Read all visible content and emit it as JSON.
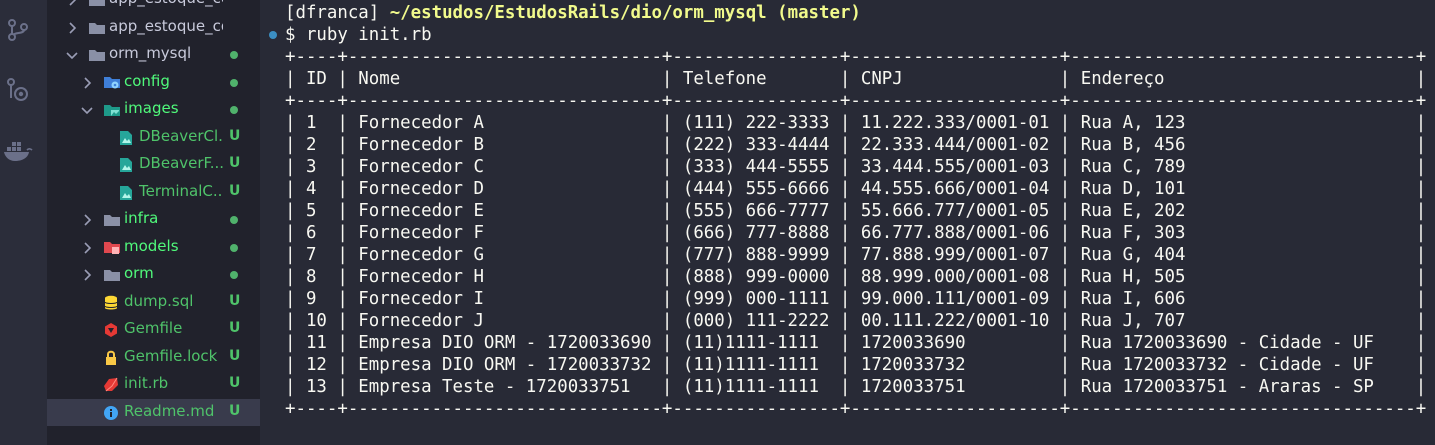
{
  "explorer": {
    "items": [
      {
        "label": "app_estoque_con...",
        "kind": "folder",
        "expanded": false,
        "indent": 0,
        "status": ""
      },
      {
        "label": "app_estoque_con...",
        "kind": "folder",
        "expanded": false,
        "indent": 0,
        "status": ""
      },
      {
        "label": "orm_mysql",
        "kind": "folder",
        "expanded": true,
        "indent": 0,
        "status": "dot"
      },
      {
        "label": "config",
        "kind": "folder-config",
        "expanded": false,
        "indent": 1,
        "status": "dot"
      },
      {
        "label": "images",
        "kind": "folder-images",
        "expanded": true,
        "indent": 1,
        "status": "dot"
      },
      {
        "label": "DBeaverCl...",
        "kind": "image",
        "expanded": null,
        "indent": 2,
        "status": "U"
      },
      {
        "label": "DBeaverF...",
        "kind": "image",
        "expanded": null,
        "indent": 2,
        "status": "U"
      },
      {
        "label": "TerminalC...",
        "kind": "image",
        "expanded": null,
        "indent": 2,
        "status": "U"
      },
      {
        "label": "infra",
        "kind": "folder",
        "expanded": false,
        "indent": 1,
        "status": "dot"
      },
      {
        "label": "models",
        "kind": "folder-models",
        "expanded": false,
        "indent": 1,
        "status": "dot"
      },
      {
        "label": "orm",
        "kind": "folder",
        "expanded": false,
        "indent": 1,
        "status": "dot"
      },
      {
        "label": "dump.sql",
        "kind": "sql",
        "expanded": null,
        "indent": 1,
        "status": "U"
      },
      {
        "label": "Gemfile",
        "kind": "gemfile",
        "expanded": null,
        "indent": 1,
        "status": "U"
      },
      {
        "label": "Gemfile.lock",
        "kind": "lock",
        "expanded": null,
        "indent": 1,
        "status": "U"
      },
      {
        "label": "init.rb",
        "kind": "ruby",
        "expanded": null,
        "indent": 1,
        "status": "U"
      },
      {
        "label": "Readme.md",
        "kind": "info",
        "expanded": null,
        "indent": 1,
        "status": "U",
        "selected": true
      }
    ]
  },
  "terminal": {
    "prompt": {
      "user": "[dfranca]",
      "path": "~/estudos/EstudosRails/dio/orm_mysql",
      "branch": "(master)"
    },
    "command": "$ ruby init.rb",
    "border": "+----+------------------------------+----------------+--------------------+---------------------------------+",
    "headers": [
      "ID",
      "Nome",
      "Telefone",
      "CNPJ",
      "Endereço"
    ],
    "rows": [
      [
        "1",
        "Fornecedor A",
        "(111) 222-3333",
        "11.222.333/0001-01",
        "Rua A, 123"
      ],
      [
        "2",
        "Fornecedor B",
        "(222) 333-4444",
        "22.333.444/0001-02",
        "Rua B, 456"
      ],
      [
        "3",
        "Fornecedor C",
        "(333) 444-5555",
        "33.444.555/0001-03",
        "Rua C, 789"
      ],
      [
        "4",
        "Fornecedor D",
        "(444) 555-6666",
        "44.555.666/0001-04",
        "Rua D, 101"
      ],
      [
        "5",
        "Fornecedor E",
        "(555) 666-7777",
        "55.666.777/0001-05",
        "Rua E, 202"
      ],
      [
        "6",
        "Fornecedor F",
        "(666) 777-8888",
        "66.777.888/0001-06",
        "Rua F, 303"
      ],
      [
        "7",
        "Fornecedor G",
        "(777) 888-9999",
        "77.888.999/0001-07",
        "Rua G, 404"
      ],
      [
        "8",
        "Fornecedor H",
        "(888) 999-0000",
        "88.999.000/0001-08",
        "Rua H, 505"
      ],
      [
        "9",
        "Fornecedor I",
        "(999) 000-1111",
        "99.000.111/0001-09",
        "Rua I, 606"
      ],
      [
        "10",
        "Fornecedor J",
        "(000) 111-2222",
        "00.111.222/0001-10",
        "Rua J, 707"
      ],
      [
        "11",
        "Empresa DIO ORM - 1720033690",
        "(11)1111-1111",
        "1720033690",
        "Rua 1720033690 - Cidade - UF"
      ],
      [
        "12",
        "Empresa DIO ORM - 1720033732",
        "(11)1111-1111",
        "1720033732",
        "Rua 1720033732 - Cidade - UF"
      ],
      [
        "13",
        "Empresa Teste - 1720033751",
        "(11)1111-1111",
        "1720033751",
        "Rua 1720033751 - Araras - SP"
      ]
    ]
  },
  "colors": {
    "terminal_bg": "#282a36",
    "sidebar_bg": "#21222c",
    "activity_bg": "#2b2d3a",
    "text": "#f8f8f2",
    "path_yellow": "#f1fa8c",
    "folder_green": "#50fa7b",
    "untracked": "#4fc36a",
    "selected_row": "#393b4c",
    "info_blue": "#8be9fd"
  }
}
